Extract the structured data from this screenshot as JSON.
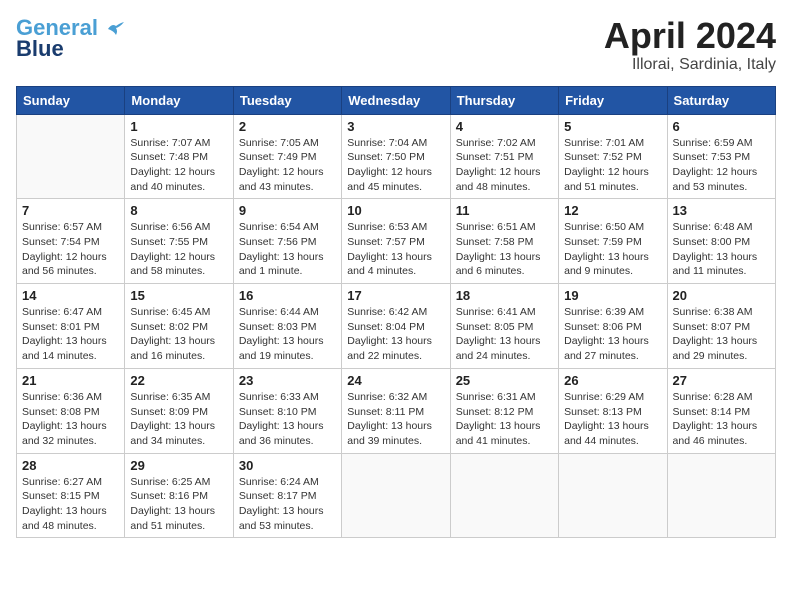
{
  "header": {
    "logo_line1": "General",
    "logo_line2": "Blue",
    "month_title": "April 2024",
    "location": "Illorai, Sardinia, Italy"
  },
  "columns": [
    "Sunday",
    "Monday",
    "Tuesday",
    "Wednesday",
    "Thursday",
    "Friday",
    "Saturday"
  ],
  "weeks": [
    [
      {
        "day": "",
        "info": ""
      },
      {
        "day": "1",
        "info": "Sunrise: 7:07 AM\nSunset: 7:48 PM\nDaylight: 12 hours\nand 40 minutes."
      },
      {
        "day": "2",
        "info": "Sunrise: 7:05 AM\nSunset: 7:49 PM\nDaylight: 12 hours\nand 43 minutes."
      },
      {
        "day": "3",
        "info": "Sunrise: 7:04 AM\nSunset: 7:50 PM\nDaylight: 12 hours\nand 45 minutes."
      },
      {
        "day": "4",
        "info": "Sunrise: 7:02 AM\nSunset: 7:51 PM\nDaylight: 12 hours\nand 48 minutes."
      },
      {
        "day": "5",
        "info": "Sunrise: 7:01 AM\nSunset: 7:52 PM\nDaylight: 12 hours\nand 51 minutes."
      },
      {
        "day": "6",
        "info": "Sunrise: 6:59 AM\nSunset: 7:53 PM\nDaylight: 12 hours\nand 53 minutes."
      }
    ],
    [
      {
        "day": "7",
        "info": "Sunrise: 6:57 AM\nSunset: 7:54 PM\nDaylight: 12 hours\nand 56 minutes."
      },
      {
        "day": "8",
        "info": "Sunrise: 6:56 AM\nSunset: 7:55 PM\nDaylight: 12 hours\nand 58 minutes."
      },
      {
        "day": "9",
        "info": "Sunrise: 6:54 AM\nSunset: 7:56 PM\nDaylight: 13 hours\nand 1 minute."
      },
      {
        "day": "10",
        "info": "Sunrise: 6:53 AM\nSunset: 7:57 PM\nDaylight: 13 hours\nand 4 minutes."
      },
      {
        "day": "11",
        "info": "Sunrise: 6:51 AM\nSunset: 7:58 PM\nDaylight: 13 hours\nand 6 minutes."
      },
      {
        "day": "12",
        "info": "Sunrise: 6:50 AM\nSunset: 7:59 PM\nDaylight: 13 hours\nand 9 minutes."
      },
      {
        "day": "13",
        "info": "Sunrise: 6:48 AM\nSunset: 8:00 PM\nDaylight: 13 hours\nand 11 minutes."
      }
    ],
    [
      {
        "day": "14",
        "info": "Sunrise: 6:47 AM\nSunset: 8:01 PM\nDaylight: 13 hours\nand 14 minutes."
      },
      {
        "day": "15",
        "info": "Sunrise: 6:45 AM\nSunset: 8:02 PM\nDaylight: 13 hours\nand 16 minutes."
      },
      {
        "day": "16",
        "info": "Sunrise: 6:44 AM\nSunset: 8:03 PM\nDaylight: 13 hours\nand 19 minutes."
      },
      {
        "day": "17",
        "info": "Sunrise: 6:42 AM\nSunset: 8:04 PM\nDaylight: 13 hours\nand 22 minutes."
      },
      {
        "day": "18",
        "info": "Sunrise: 6:41 AM\nSunset: 8:05 PM\nDaylight: 13 hours\nand 24 minutes."
      },
      {
        "day": "19",
        "info": "Sunrise: 6:39 AM\nSunset: 8:06 PM\nDaylight: 13 hours\nand 27 minutes."
      },
      {
        "day": "20",
        "info": "Sunrise: 6:38 AM\nSunset: 8:07 PM\nDaylight: 13 hours\nand 29 minutes."
      }
    ],
    [
      {
        "day": "21",
        "info": "Sunrise: 6:36 AM\nSunset: 8:08 PM\nDaylight: 13 hours\nand 32 minutes."
      },
      {
        "day": "22",
        "info": "Sunrise: 6:35 AM\nSunset: 8:09 PM\nDaylight: 13 hours\nand 34 minutes."
      },
      {
        "day": "23",
        "info": "Sunrise: 6:33 AM\nSunset: 8:10 PM\nDaylight: 13 hours\nand 36 minutes."
      },
      {
        "day": "24",
        "info": "Sunrise: 6:32 AM\nSunset: 8:11 PM\nDaylight: 13 hours\nand 39 minutes."
      },
      {
        "day": "25",
        "info": "Sunrise: 6:31 AM\nSunset: 8:12 PM\nDaylight: 13 hours\nand 41 minutes."
      },
      {
        "day": "26",
        "info": "Sunrise: 6:29 AM\nSunset: 8:13 PM\nDaylight: 13 hours\nand 44 minutes."
      },
      {
        "day": "27",
        "info": "Sunrise: 6:28 AM\nSunset: 8:14 PM\nDaylight: 13 hours\nand 46 minutes."
      }
    ],
    [
      {
        "day": "28",
        "info": "Sunrise: 6:27 AM\nSunset: 8:15 PM\nDaylight: 13 hours\nand 48 minutes."
      },
      {
        "day": "29",
        "info": "Sunrise: 6:25 AM\nSunset: 8:16 PM\nDaylight: 13 hours\nand 51 minutes."
      },
      {
        "day": "30",
        "info": "Sunrise: 6:24 AM\nSunset: 8:17 PM\nDaylight: 13 hours\nand 53 minutes."
      },
      {
        "day": "",
        "info": ""
      },
      {
        "day": "",
        "info": ""
      },
      {
        "day": "",
        "info": ""
      },
      {
        "day": "",
        "info": ""
      }
    ]
  ]
}
